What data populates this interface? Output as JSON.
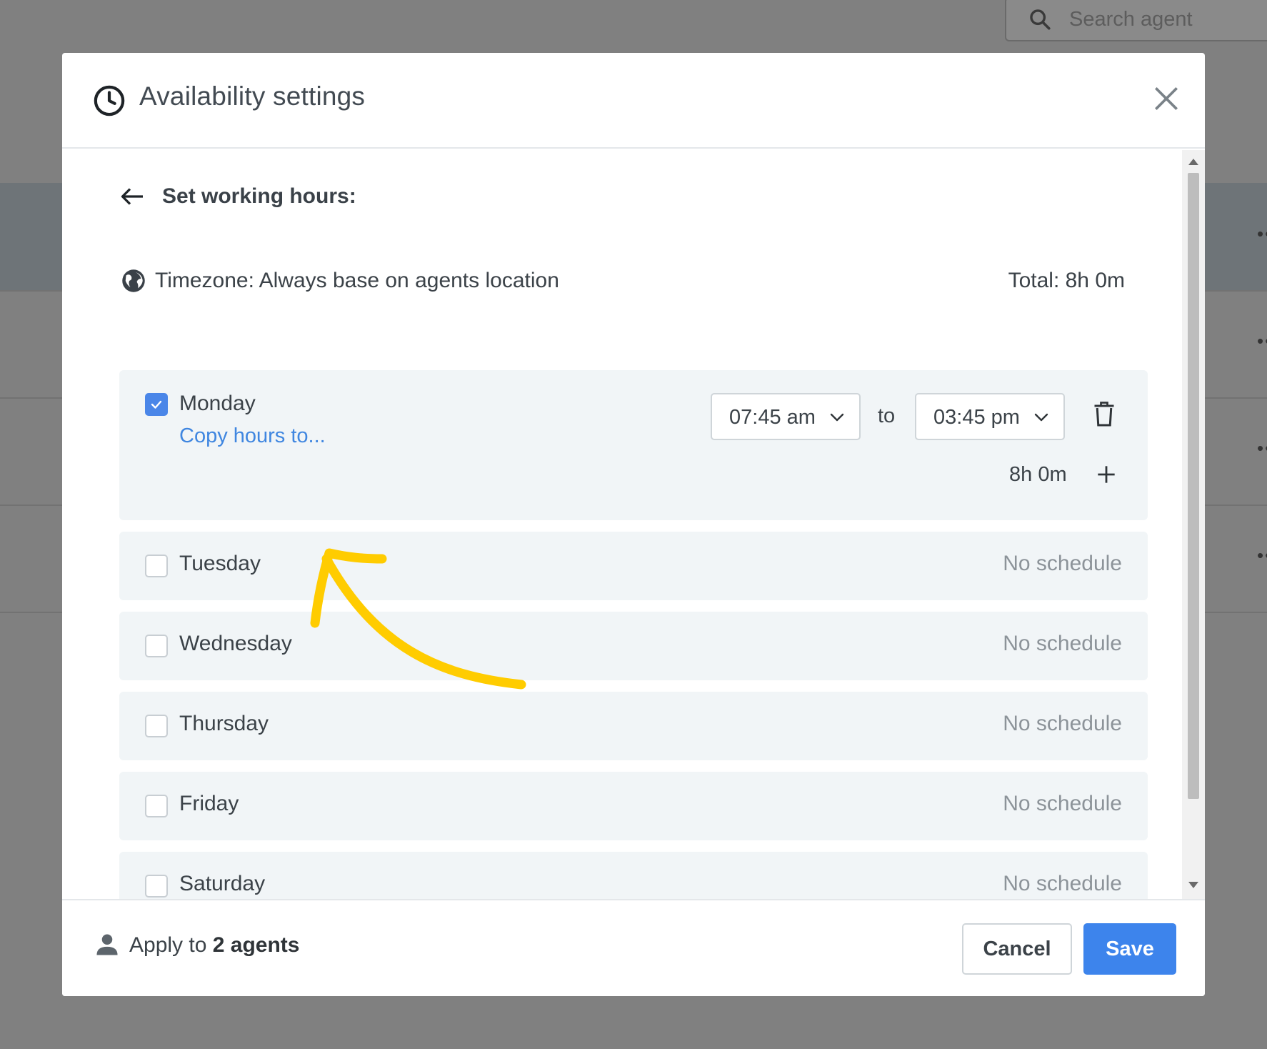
{
  "background": {
    "search_placeholder": "Search agent"
  },
  "modal": {
    "title": "Availability settings",
    "back_label": "Set working hours:",
    "timezone_label": "Timezone: Always base on agents location",
    "total_label": "Total: 8h 0m",
    "days": [
      {
        "name": "Monday",
        "checked": true,
        "copy_label": "Copy hours to...",
        "from": "07:45 am",
        "to_word": "to",
        "to": "03:45 pm",
        "duration": "8h 0m"
      },
      {
        "name": "Tuesday",
        "checked": false,
        "status": "No schedule"
      },
      {
        "name": "Wednesday",
        "checked": false,
        "status": "No schedule"
      },
      {
        "name": "Thursday",
        "checked": false,
        "status": "No schedule"
      },
      {
        "name": "Friday",
        "checked": false,
        "status": "No schedule"
      },
      {
        "name": "Saturday",
        "checked": false,
        "status": "No schedule"
      }
    ],
    "footer": {
      "apply_prefix": "Apply to ",
      "apply_count": "2 agents",
      "cancel_label": "Cancel",
      "save_label": "Save"
    }
  },
  "colors": {
    "accent": "#3d84ec",
    "link": "#3f86e0",
    "annotation": "#ffcc00",
    "row_bg": "#f1f5f7"
  }
}
